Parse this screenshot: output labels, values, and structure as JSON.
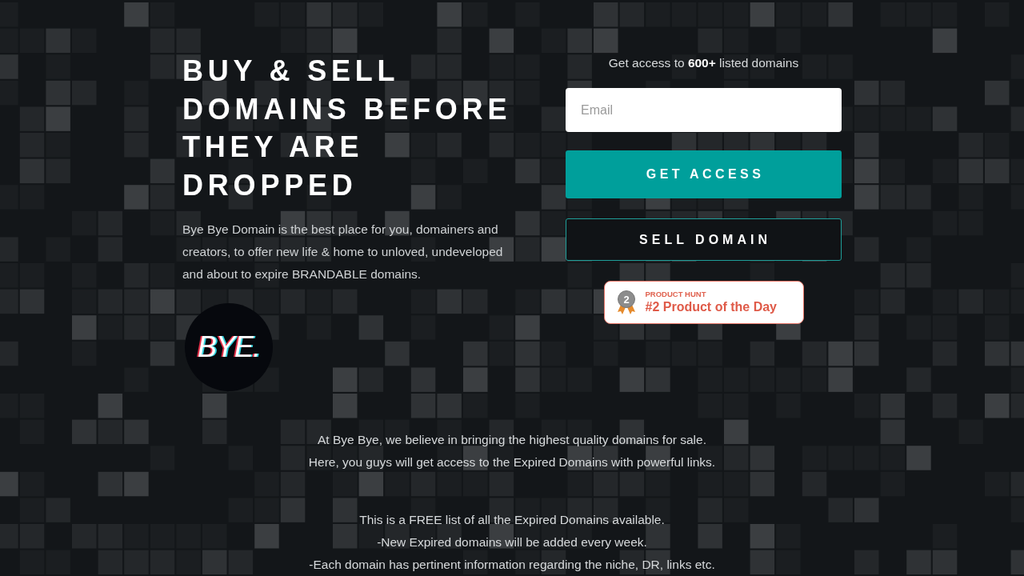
{
  "hero": {
    "title": "BUY & SELL DOMAINS BEFORE THEY ARE DROPPED",
    "description": "Bye Bye Domain is the best place for you, domainers and creators, to offer new life & home to unloved, undeveloped and about to expire BRANDABLE domains.",
    "logo": {
      "text": "BYE."
    }
  },
  "signup": {
    "headline": "Get access to **600+** listed domains",
    "email": {
      "placeholder": "Email"
    },
    "buttons": [
      {
        "label": "GET ACCESS",
        "kind": "primary"
      },
      {
        "label": "SELL DOMAIN",
        "kind": "outline"
      }
    ],
    "badge": {
      "rank": "2",
      "source": "PRODUCT HUNT",
      "title": "#2 Product of the Day"
    }
  },
  "about": {
    "paragraphs": [
      [
        "At Bye Bye, we believe in bringing the highest quality domains for sale.",
        "Here, you guys will get access to the Expired Domains with powerful links."
      ],
      [
        "This is a FREE list of all the Expired Domains available.",
        "-New Expired domains will be added every week.",
        "-Each domain has pertinent information regarding the niche, DR, links etc."
      ]
    ]
  }
}
